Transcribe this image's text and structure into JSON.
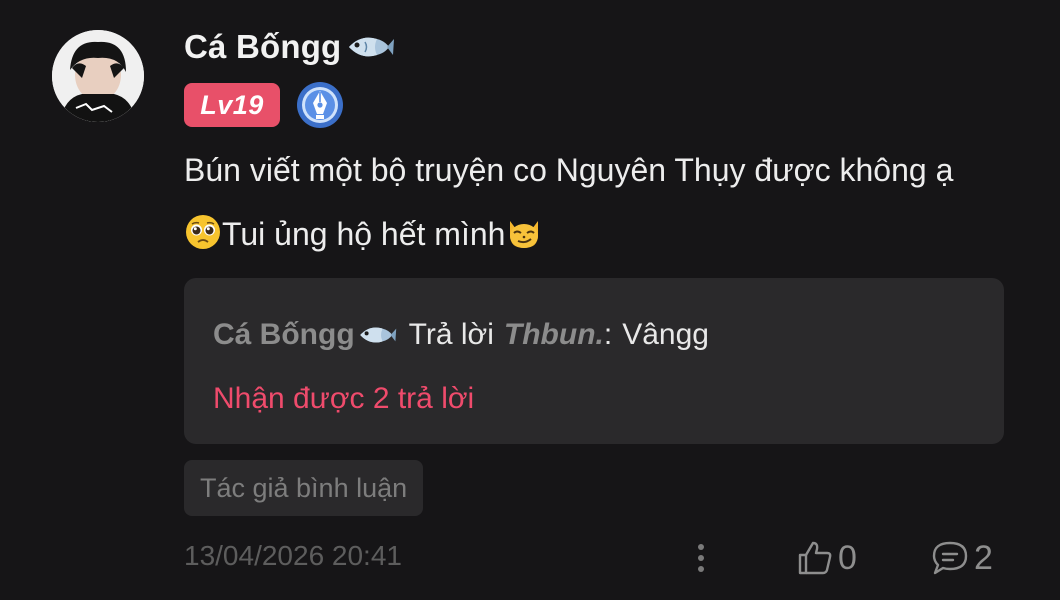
{
  "comment": {
    "author": "Cá Bốngg",
    "author_icon": "fish-emoji-icon",
    "level": "Lv19",
    "level_color": "#e85069",
    "badge_icon": "pen-nib-badge-icon",
    "text_part1": "Bún viết một bộ truyện co Nguyên Thụy được không ạ",
    "emoji1": "pleading-face-emoji-icon",
    "text_part2": "Tui ủng hộ hết mình",
    "emoji2": "smirking-cat-emoji-icon"
  },
  "reply_preview": {
    "author": "Cá Bốngg",
    "verb": "Trả lời",
    "target": "Thbun.",
    "colon": ":",
    "message": "Vângg",
    "count_label": "Nhận được 2 trả lời",
    "count_color": "#ef4b6c"
  },
  "tag": "Tác giả bình luận",
  "footer": {
    "timestamp": "13/04/2026 20:41",
    "more_icon": "more-vertical-icon",
    "like_icon": "thumbs-up-icon",
    "like_count": "0",
    "reply_icon": "comment-bubble-icon",
    "reply_count": "2"
  }
}
